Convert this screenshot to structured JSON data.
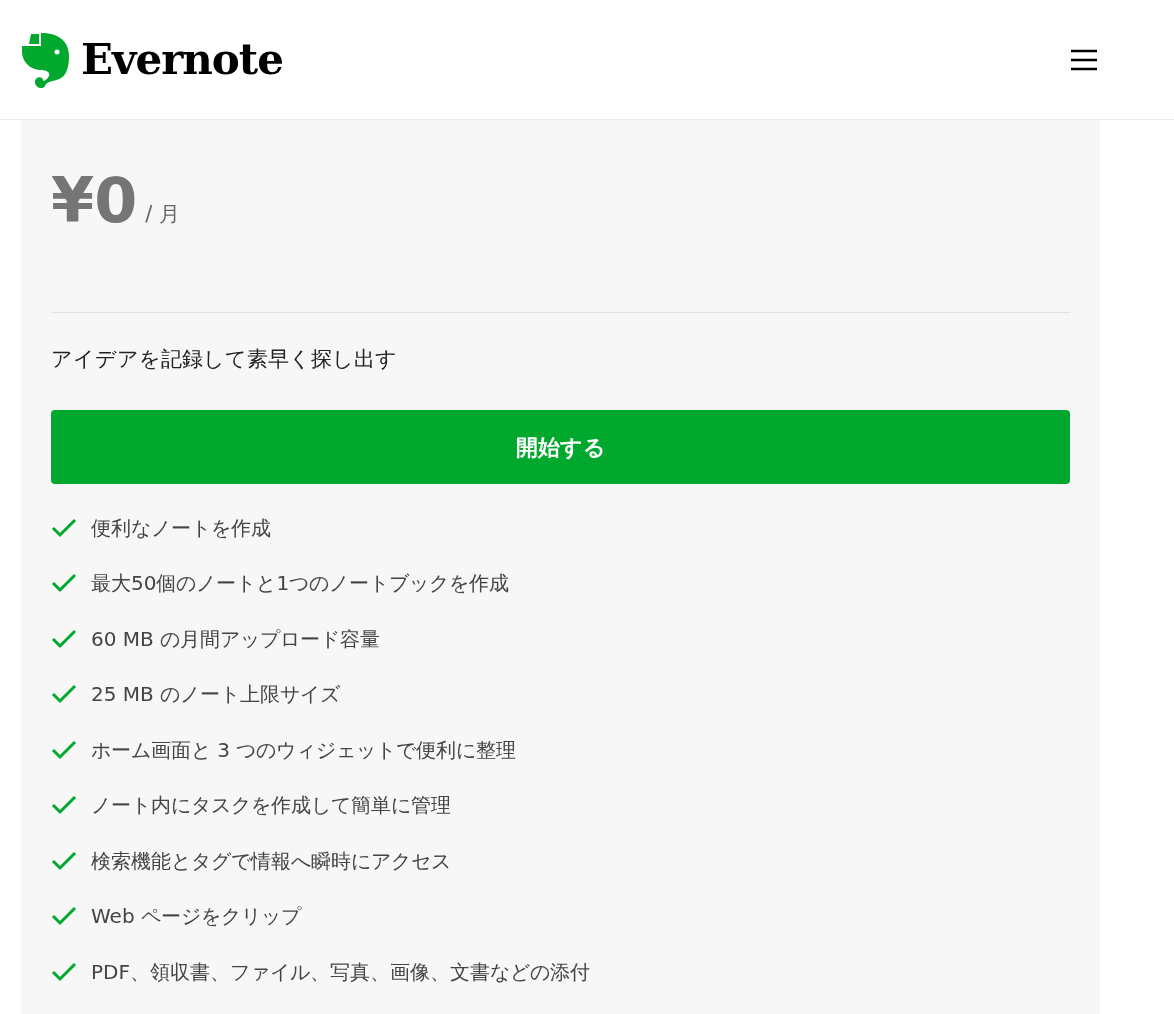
{
  "header": {
    "brand": "Evernote"
  },
  "plan": {
    "price": "¥0",
    "period": "/ 月",
    "tagline": "アイデアを記録して素早く探し出す",
    "cta": "開始する",
    "features": [
      "便利なノートを作成",
      "最大50個のノートと1つのノートブックを作成",
      "60 MB の月間アップロード容量",
      "25 MB のノート上限サイズ",
      "ホーム画面と 3 つのウィジェットで便利に整理",
      "ノート内にタスクを作成して簡単に管理",
      "検索機能とタグで情報へ瞬時にアクセス",
      "Web ページをクリップ",
      "PDF、領収書、ファイル、写真、画像、文書などの添付"
    ]
  }
}
